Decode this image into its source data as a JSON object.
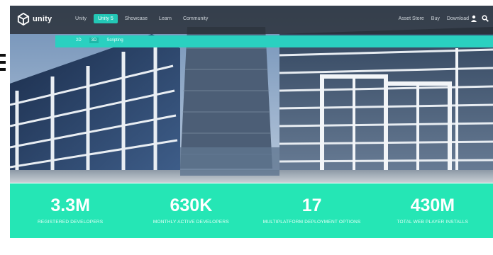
{
  "nav": {
    "logo_text": "unity",
    "items": [
      {
        "label": "Unity",
        "active": false
      },
      {
        "label": "Unity 5",
        "active": true
      },
      {
        "label": "Showcase",
        "active": false
      },
      {
        "label": "Learn",
        "active": false
      },
      {
        "label": "Community",
        "active": false
      }
    ],
    "right_links": [
      "Asset Store",
      "Buy",
      "Download"
    ],
    "icons": [
      "user-icon",
      "search-icon"
    ]
  },
  "subnav": {
    "items": [
      {
        "label": "2D",
        "active": false
      },
      {
        "label": "3D",
        "active": true
      },
      {
        "label": "Scripting",
        "active": false
      }
    ]
  },
  "stats": [
    {
      "value": "3.3M",
      "label": "REGISTERED DEVELOPERS"
    },
    {
      "value": "630K",
      "label": "MONTHLY ACTIVE DEVELOPERS"
    },
    {
      "value": "17",
      "label": "MULTIPLATFORM DEPLOYMENT OPTIONS"
    },
    {
      "value": "430M",
      "label": "TOTAL WEB PLAYER INSTALLS"
    }
  ],
  "colors": {
    "accent": "#25e6b5",
    "subnav": "#2ad0c0",
    "nav_bg": "#2d3239"
  }
}
